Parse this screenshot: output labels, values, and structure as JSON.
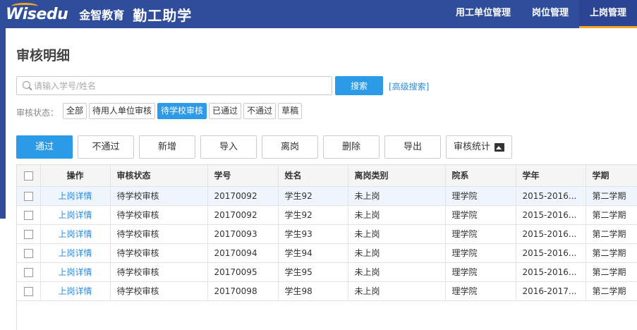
{
  "header": {
    "brand": "Wisedu",
    "brand_cn": "金智教育",
    "app_title": "勤工助学",
    "nav": [
      {
        "label": "用工单位管理",
        "active": false
      },
      {
        "label": "岗位管理",
        "active": false
      },
      {
        "label": "上岗管理",
        "active": true
      }
    ]
  },
  "page": {
    "title": "审核明细"
  },
  "search": {
    "placeholder": "请输入学号/姓名",
    "value": "",
    "button_label": "搜索",
    "advanced_label": "[高级搜索]"
  },
  "status_filter": {
    "label": "审核状态：",
    "options": [
      "全部",
      "待用人单位审核",
      "待学校审核",
      "已通过",
      "不通过",
      "草稿"
    ],
    "selected": "待学校审核"
  },
  "toolbar": {
    "approve": "通过",
    "reject": "不通过",
    "add": "新增",
    "import": "导入",
    "leave": "离岗",
    "delete": "删除",
    "export": "导出",
    "stats": "审核统计"
  },
  "table": {
    "headers": [
      "操作",
      "审核状态",
      "学号",
      "姓名",
      "离岗类别",
      "院系",
      "学年",
      "学期"
    ],
    "rows": [
      {
        "op": "上岗详情",
        "status": "待学校审核",
        "id": "20170092",
        "name": "学生92",
        "leave_type": "未上岗",
        "dept": "理学院",
        "year": "2015-2016...",
        "term": "第二学期"
      },
      {
        "op": "上岗详情",
        "status": "待学校审核",
        "id": "20170092",
        "name": "学生92",
        "leave_type": "未上岗",
        "dept": "理学院",
        "year": "2015-2016...",
        "term": "第二学期"
      },
      {
        "op": "上岗详情",
        "status": "待学校审核",
        "id": "20170093",
        "name": "学生93",
        "leave_type": "未上岗",
        "dept": "理学院",
        "year": "2015-2016...",
        "term": "第二学期"
      },
      {
        "op": "上岗详情",
        "status": "待学校审核",
        "id": "20170094",
        "name": "学生94",
        "leave_type": "未上岗",
        "dept": "理学院",
        "year": "2015-2016...",
        "term": "第二学期"
      },
      {
        "op": "上岗详情",
        "status": "待学校审核",
        "id": "20170095",
        "name": "学生95",
        "leave_type": "未上岗",
        "dept": "理学院",
        "year": "2015-2016...",
        "term": "第二学期"
      },
      {
        "op": "上岗详情",
        "status": "待学校审核",
        "id": "20170098",
        "name": "学生98",
        "leave_type": "未上岗",
        "dept": "理学院",
        "year": "2016-2017...",
        "term": "第二学期"
      }
    ]
  },
  "colors": {
    "header_bg": "#2f4d9a",
    "accent": "#2d9ae8",
    "nav_underline": "#f5a623",
    "link": "#2d8bd9"
  }
}
